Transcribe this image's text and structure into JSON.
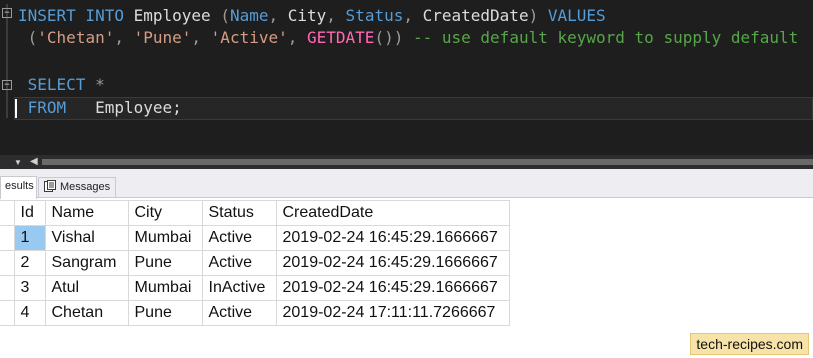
{
  "editor": {
    "line1": {
      "kw1": "INSERT INTO",
      "table": "Employee",
      "open": "(",
      "c1": "Name",
      "c2": "City",
      "c3": "Status",
      "c4": "CreatedDate",
      "close": ")",
      "kw2": "VALUES"
    },
    "line2": {
      "open": "(",
      "v1": "'Chetan'",
      "v2": "'Pune'",
      "v3": "'Active'",
      "fn": "GETDATE",
      "paren": "())",
      "comment": "-- use default keyword to supply default"
    },
    "line4": {
      "kw": "SELECT",
      "star": "*"
    },
    "line5": {
      "kw": "FROM",
      "table": "Employee;"
    }
  },
  "tabs": {
    "results": "esults",
    "messages": "Messages"
  },
  "grid": {
    "columns": [
      "Id",
      "Name",
      "City",
      "Status",
      "CreatedDate"
    ],
    "rows": [
      [
        "1",
        "Vishal",
        "Mumbai",
        "Active",
        "2019-02-24 16:45:29.1666667"
      ],
      [
        "2",
        "Sangram",
        "Pune",
        "Active",
        "2019-02-24 16:45:29.1666667"
      ],
      [
        "3",
        "Atul",
        "Mumbai",
        "InActive",
        "2019-02-24 16:45:29.1666667"
      ],
      [
        "4",
        "Chetan",
        "Pune",
        "Active",
        "2019-02-24 17:11:11.7266667"
      ]
    ]
  },
  "watermark": "tech-recipes.com",
  "colors": {
    "editor_bg": "#1e1e1e",
    "keyword": "#569cd6",
    "string": "#d69d85",
    "function": "#ff69b4",
    "comment": "#57a64a",
    "selected_cell": "#99c9ef"
  }
}
